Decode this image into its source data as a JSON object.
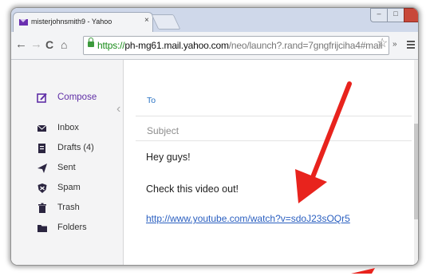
{
  "browser": {
    "tab_title": "misterjohnsmith9 - Yahoo",
    "tab_close": "×",
    "url_scheme": "https://",
    "url_host": "ph-mg61.mail.yahoo.com",
    "url_path": "/neo/launch?.rand=7gngfrijciha4#mail",
    "more_label": "»",
    "window_min": "–",
    "window_max": "□"
  },
  "sidebar": {
    "items": [
      {
        "label": "Compose",
        "icon": "compose-icon"
      },
      {
        "label": "Inbox",
        "icon": "envelope-icon"
      },
      {
        "label": "Drafts (4)",
        "icon": "drafts-icon"
      },
      {
        "label": "Sent",
        "icon": "paper-plane-icon"
      },
      {
        "label": "Spam",
        "icon": "shield-icon"
      },
      {
        "label": "Trash",
        "icon": "trash-icon"
      },
      {
        "label": "Folders",
        "icon": "folder-icon"
      }
    ]
  },
  "compose": {
    "to_label": "To",
    "subject_placeholder": "Subject",
    "body_lines": [
      "Hey guys!",
      "Check this video out!"
    ],
    "link": "http://www.youtube.com/watch?v=sdoJ23sOQr5"
  },
  "colors": {
    "yahoo_purple": "#5f2ea6",
    "arrow_red": "#e8231d"
  }
}
